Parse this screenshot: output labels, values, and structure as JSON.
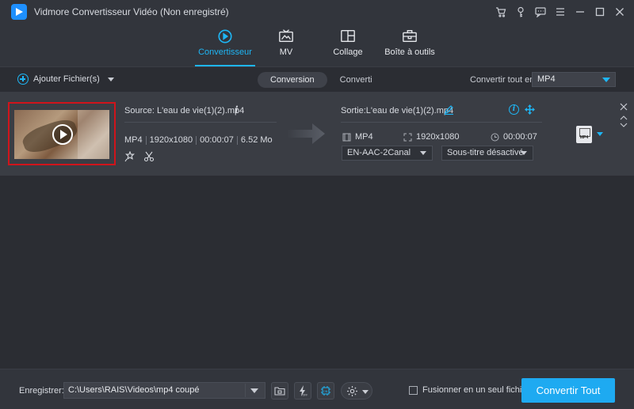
{
  "window": {
    "title": "Vidmore Convertisseur Vidéo (Non enregistré)",
    "controls": [
      "cart-icon",
      "key-icon",
      "feedback-icon",
      "menu-icon",
      "minimize-icon",
      "maximize-icon",
      "close-icon"
    ]
  },
  "nav": {
    "tabs": [
      {
        "label": "Convertisseur",
        "icon": "convert-icon",
        "active": true
      },
      {
        "label": "MV",
        "icon": "mv-icon",
        "active": false
      },
      {
        "label": "Collage",
        "icon": "collage-icon",
        "active": false
      },
      {
        "label": "Boîte à outils",
        "icon": "toolbox-icon",
        "active": false
      }
    ]
  },
  "toolbar": {
    "add_files_label": "Ajouter Fichier(s)",
    "subtabs": [
      "Conversion",
      "Converti"
    ],
    "convert_all_label": "Convertir tout en:",
    "convert_all_format": "MP4"
  },
  "file": {
    "source_label": "Source: L'eau de vie(1)(2).mp4",
    "format": "MP4",
    "resolution": "1920x1080",
    "duration": "00:00:07",
    "size": "6.52 Mo",
    "output_label": "Sortie:L'eau de vie(1)(2).mp4",
    "out_format": "MP4",
    "out_resolution": "1920x1080",
    "out_duration": "00:00:07",
    "audio_track": "EN-AAC-2Canal",
    "subtitle": "Sous-titre désactivé",
    "format_badge": "MP4"
  },
  "bottom": {
    "save_label": "Enregistrer:",
    "save_path": "C:\\Users\\RAIS\\Videos\\mp4 coupé",
    "merge_label": "Fusionner en un seul fichier",
    "convert_button": "Convertir Tout"
  },
  "colors": {
    "accent": "#1eb6f5",
    "button": "#1eaaf1",
    "highlight_border": "#d0141b"
  }
}
